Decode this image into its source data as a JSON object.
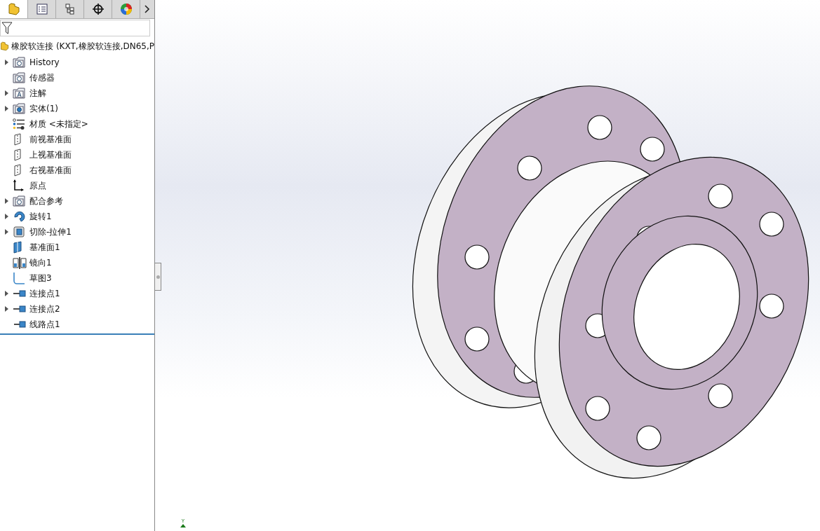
{
  "tabs": [
    {
      "kind": "feature",
      "selected": true
    },
    {
      "kind": "property",
      "selected": false
    },
    {
      "kind": "config",
      "selected": false
    },
    {
      "kind": "dimxpert",
      "selected": false
    },
    {
      "kind": "display",
      "selected": false
    }
  ],
  "tree": {
    "root": {
      "label": "橡胶软连接 (KXT,橡胶软连接,DN65,P"
    },
    "items": [
      {
        "label": "History",
        "kind": "history",
        "expandable": true
      },
      {
        "label": "传感器",
        "kind": "sensor",
        "expandable": false
      },
      {
        "label": "注解",
        "kind": "annotation",
        "expandable": true
      },
      {
        "label": "实体(1)",
        "kind": "solid",
        "expandable": true
      },
      {
        "label": "材质 <未指定>",
        "kind": "material",
        "expandable": false
      },
      {
        "label": "前视基准面",
        "kind": "plane",
        "expandable": false
      },
      {
        "label": "上视基准面",
        "kind": "plane",
        "expandable": false
      },
      {
        "label": "右视基准面",
        "kind": "plane",
        "expandable": false
      },
      {
        "label": "原点",
        "kind": "origin",
        "expandable": false
      },
      {
        "label": "配合参考",
        "kind": "mate",
        "expandable": true
      },
      {
        "label": "旋转1",
        "kind": "revolve",
        "expandable": true
      },
      {
        "label": "切除-拉伸1",
        "kind": "cut",
        "expandable": true
      },
      {
        "label": "基准面1",
        "kind": "refplane",
        "expandable": false
      },
      {
        "label": "镜向1",
        "kind": "mirror",
        "expandable": false
      },
      {
        "label": "草图3",
        "kind": "sketch",
        "expandable": false
      },
      {
        "label": "连接点1",
        "kind": "cpoint",
        "expandable": true
      },
      {
        "label": "连接点2",
        "kind": "cpoint",
        "expandable": true
      },
      {
        "label": "线路点1",
        "kind": "rpoint",
        "expandable": false
      }
    ]
  },
  "viewport": {
    "triad": {
      "axis": "Y"
    }
  }
}
